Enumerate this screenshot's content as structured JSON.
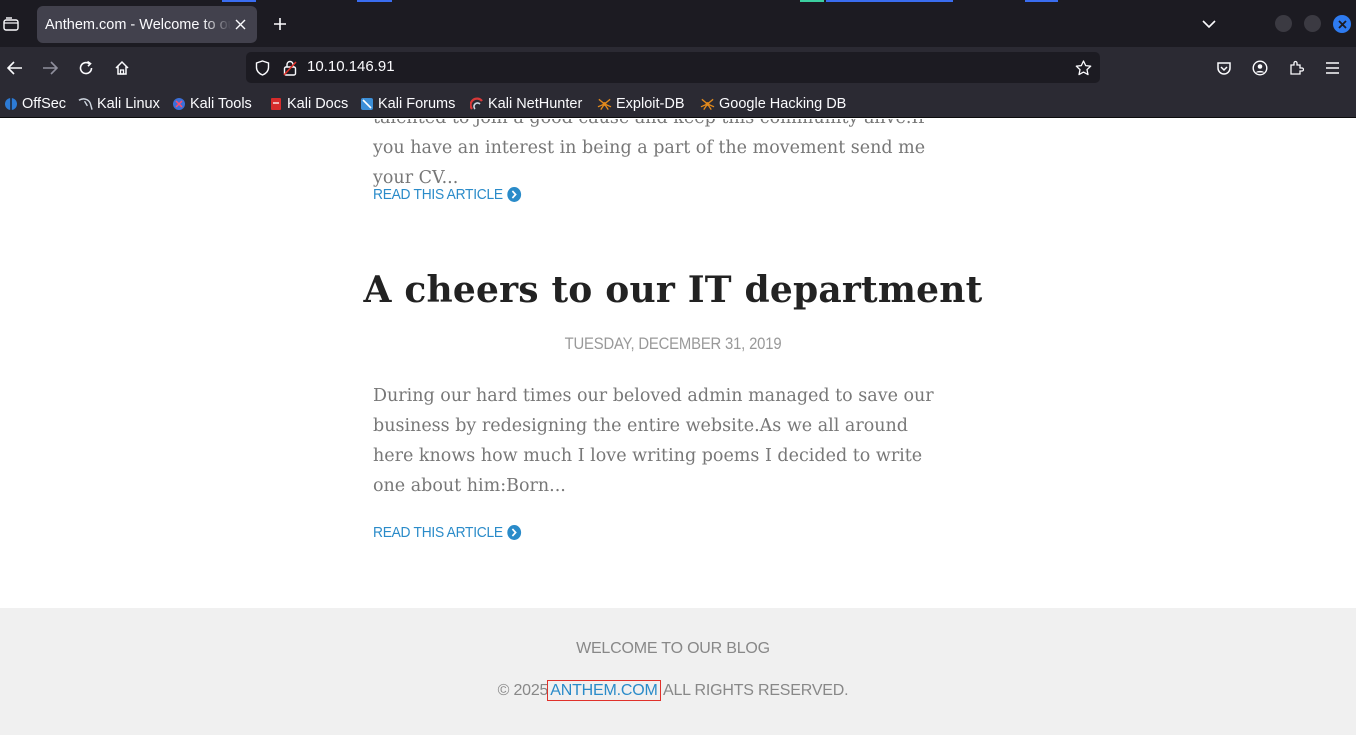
{
  "browser": {
    "tab_title": "Anthem.com - Welcome to our blog",
    "url": "10.10.146.91",
    "bookmarks": [
      {
        "label": "OffSec",
        "icon": "offsec-icon",
        "color": "#2d7bd6"
      },
      {
        "label": "Kali Linux",
        "icon": "kali-dragon-icon",
        "color": "#cfd6e0"
      },
      {
        "label": "Kali Tools",
        "icon": "kali-tools-icon",
        "color": "#3b6fd9"
      },
      {
        "label": "Kali Docs",
        "icon": "kali-docs-icon",
        "color": "#d62b2b"
      },
      {
        "label": "Kali Forums",
        "icon": "kali-forums-icon",
        "color": "#3c8fd8"
      },
      {
        "label": "Kali NetHunter",
        "icon": "nethunter-icon",
        "color": "#d83838"
      },
      {
        "label": "Exploit-DB",
        "icon": "exploit-db-icon",
        "color": "#e38a1c"
      },
      {
        "label": "Google Hacking DB",
        "icon": "ghdb-icon",
        "color": "#e38a1c"
      }
    ]
  },
  "page": {
    "prev_excerpt": "talented to join a good cause and keep this community alive.If you have an interest in being a part of the movement send me your CV...",
    "read_more_label": "READ THIS ARTICLE",
    "post": {
      "title": "A cheers to our IT department",
      "date": "TUESDAY, DECEMBER 31, 2019",
      "excerpt": "During our hard times our beloved admin managed to save our business by redesigning the entire website.As we all around here knows how much I love writing poems I decided to write one about him:Born..."
    },
    "footer": {
      "title": "WELCOME TO OUR BLOG",
      "copy_prefix": "© 2025",
      "copy_link": "ANTHEM.COM",
      "copy_suffix": "ALL RIGHTS RESERVED."
    }
  },
  "colors": {
    "link": "#2a8bc9",
    "highlight_box": "#e0312a"
  }
}
